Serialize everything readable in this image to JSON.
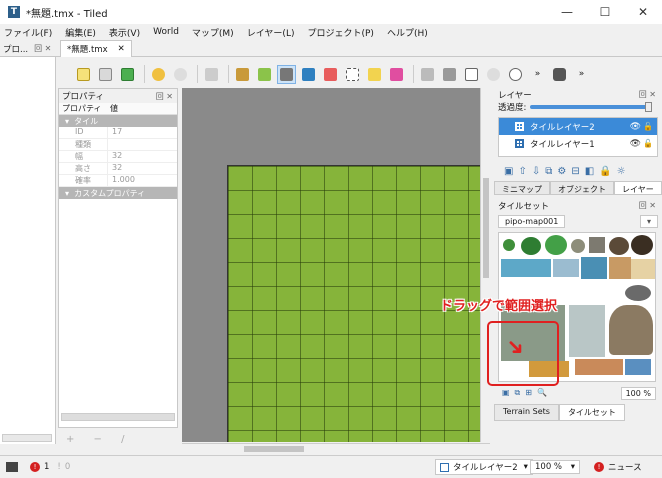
{
  "window": {
    "title": "*無題.tmx - Tiled",
    "minimize": "—",
    "maximize": "☐",
    "close": "✕"
  },
  "menu": [
    "ファイル(F)",
    "編集(E)",
    "表示(V)",
    "World",
    "マップ(M)",
    "レイヤー(L)",
    "プロジェクト(P)",
    "ヘルプ(H)"
  ],
  "left_dock": {
    "title": "プロ...",
    "controls": "回 ✕"
  },
  "doc_tab": {
    "label": "*無題.tmx",
    "close": "✕"
  },
  "properties": {
    "title": "プロパティ",
    "controls": "回 ✕",
    "col_property": "プロパティ",
    "col_value": "値",
    "group_tile": "タイル",
    "rows": [
      {
        "key": "ID",
        "value": "17"
      },
      {
        "key": "種類",
        "value": ""
      },
      {
        "key": "幅",
        "value": "32"
      },
      {
        "key": "高さ",
        "value": "32"
      },
      {
        "key": "確率",
        "value": "1.000"
      }
    ],
    "group_custom": "カスタムプロパティ",
    "tools": "+ − /"
  },
  "layers_panel": {
    "title": "レイヤー",
    "controls": "回 ✕",
    "opacity_label": "透過度:",
    "opacity_value": 1.0,
    "layers": [
      {
        "name": "タイルレイヤー2",
        "selected": true
      },
      {
        "name": "タイルレイヤー1",
        "selected": false
      }
    ],
    "tabs": [
      "ミニマップ",
      "オブジェクト",
      "レイヤー"
    ]
  },
  "tileset_panel": {
    "title": "タイルセット",
    "controls": "回 ✕",
    "tileset_name": "pipo-map001",
    "zoom": "100 %",
    "tabs": [
      "Terrain Sets",
      "タイルセット"
    ]
  },
  "annotation": {
    "text": "ドラッグで範囲選択"
  },
  "status": {
    "errors": "1",
    "warnings": "0",
    "layer": "タイルレイヤー2",
    "zoom": "100 %",
    "news": "ニュース"
  },
  "colors": {
    "accent": "#3b8ad8",
    "grass": "#86b43a",
    "annotation": "#e02020"
  }
}
